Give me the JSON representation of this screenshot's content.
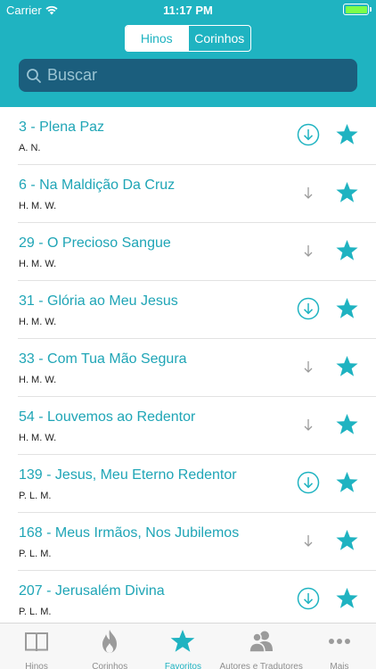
{
  "status": {
    "carrier": "Carrier",
    "time": "11:17 PM"
  },
  "segmented": {
    "left": "Hinos",
    "right": "Corinhos",
    "selected": "Hinos"
  },
  "search": {
    "placeholder": "Buscar"
  },
  "colors": {
    "accent": "#1fb3c1",
    "search_bg": "#1b5e7d"
  },
  "items": [
    {
      "title": "3 - Plena Paz",
      "author": "A. N.",
      "download": "circle"
    },
    {
      "title": "6 - Na Maldição Da Cruz",
      "author": "H. M. W.",
      "download": "plain"
    },
    {
      "title": "29 - O Precioso Sangue",
      "author": "H. M. W.",
      "download": "plain"
    },
    {
      "title": "31 - Glória ao Meu Jesus",
      "author": "H. M. W.",
      "download": "circle"
    },
    {
      "title": "33 - Com Tua Mão Segura",
      "author": "H. M. W.",
      "download": "plain"
    },
    {
      "title": "54 - Louvemos ao Redentor",
      "author": "H. M. W.",
      "download": "plain"
    },
    {
      "title": "139 - Jesus, Meu Eterno Redentor",
      "author": "P. L. M.",
      "download": "circle"
    },
    {
      "title": "168 - Meus Irmãos, Nos Jubilemos",
      "author": "P. L. M.",
      "download": "plain"
    },
    {
      "title": "207 - Jerusalém Divina",
      "author": "P. L. M.",
      "download": "circle"
    }
  ],
  "tabs": [
    {
      "label": "Hinos",
      "icon": "book-icon",
      "active": false
    },
    {
      "label": "Corinhos",
      "icon": "flame-icon",
      "active": false
    },
    {
      "label": "Favoritos",
      "icon": "star-icon",
      "active": true
    },
    {
      "label": "Autores e Tradutores",
      "icon": "people-icon",
      "active": false
    },
    {
      "label": "Mais",
      "icon": "more-icon",
      "active": false
    }
  ]
}
